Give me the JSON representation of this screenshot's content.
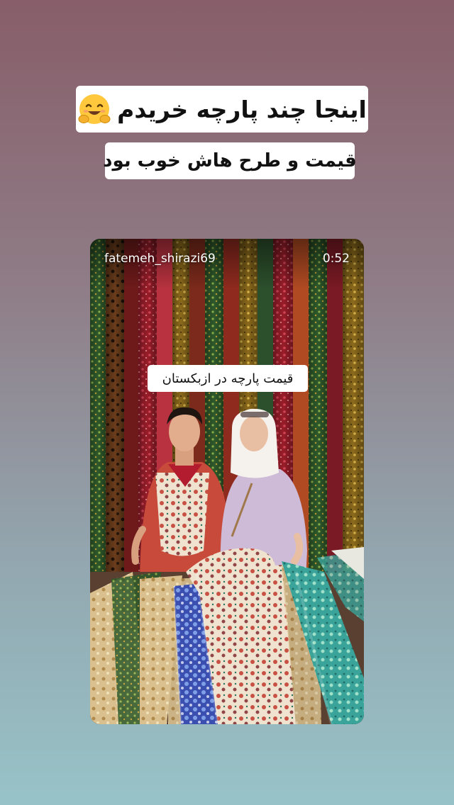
{
  "story": {
    "caption_line_1": "اینجا چند پارچه خریدم",
    "caption_line_1_emoji": "hugging-face-emoji",
    "caption_line_2": "قیمت و طرح هاش خوب بود"
  },
  "reel": {
    "username": "fatemeh_shirazi69",
    "duration": "0:52",
    "overlay_text": "قیمت پارچه در ازبکستان"
  },
  "colors": {
    "background_top": "#875e69",
    "background_bottom": "#97c3c8",
    "sticker_bg": "#ffffff",
    "sticker_text": "#111111"
  }
}
